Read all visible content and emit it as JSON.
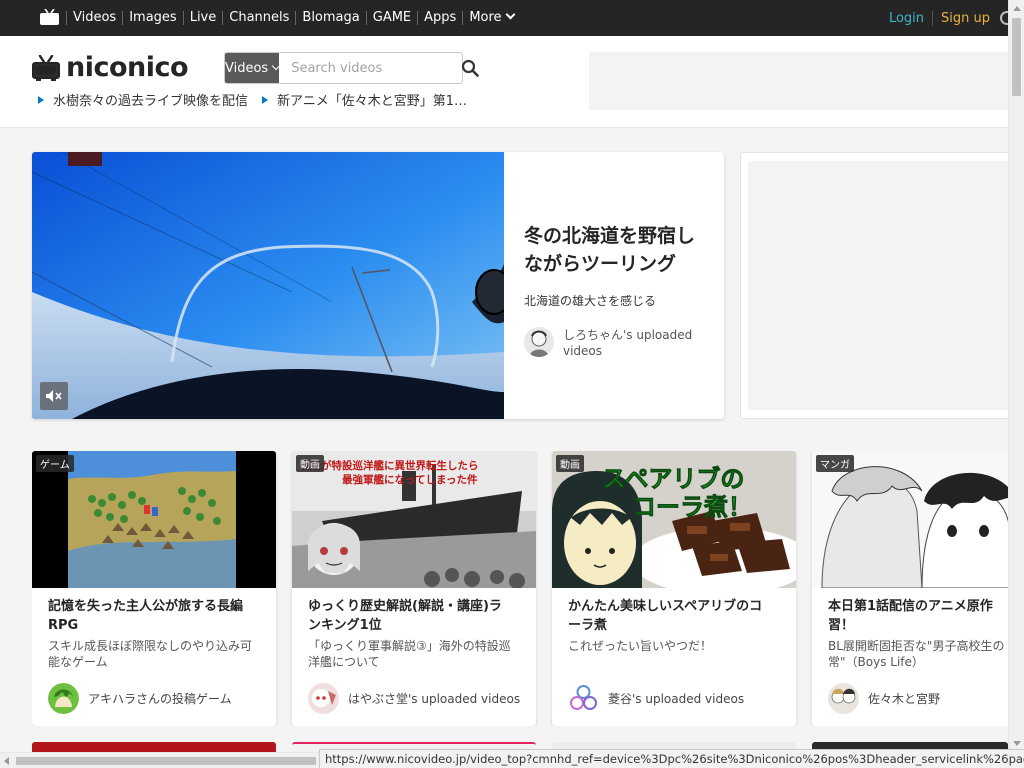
{
  "topbar": {
    "nav": [
      "Videos",
      "Images",
      "Live",
      "Channels",
      "Blomaga",
      "GAME",
      "Apps",
      "More"
    ],
    "login": "Login",
    "signup": "Sign up"
  },
  "header": {
    "brand": "niconico",
    "search_scope": "Videos",
    "search_placeholder": "Search videos",
    "news": [
      "水樹奈々の過去ライブ映像を配信",
      "新アニメ「佐々木と宮野」第1…"
    ]
  },
  "hero": {
    "title_line1": "冬の北海道を野宿し",
    "title_line2": "ながらツーリング",
    "description": "北海道の雄大さを感じる",
    "owner_line1": "しろちゃん's uploaded",
    "owner_line2": "videos"
  },
  "cards": [
    {
      "badge": "ゲーム",
      "title_line1": "記憶を失った主人公が旅する長編",
      "title_line2": "RPG",
      "desc_line1": "スキル成長ほぼ際限なしのやり込み可",
      "desc_line2": "能なゲーム",
      "owner": "アキハラさんの投稿ゲーム"
    },
    {
      "badge": "動画",
      "title_line1": "ゆっくり歴史解説(解説・講座)ラ",
      "title_line2": "ンキング1位",
      "desc_line1": "「ゆっくり軍事解説③」海外の特設巡",
      "desc_line2": "洋艦について",
      "owner": "はやぶさ堂's uploaded videos",
      "thumb_text": "商船が特設巡洋艦に異世界転生したら最強軍艦になってしまった件"
    },
    {
      "badge": "動画",
      "title_line1": "かんたん美味しいスペアリブのコ",
      "title_line2": "ーラ煮",
      "desc_line1": "これぜったい旨いやつだ！",
      "desc_line2": "",
      "owner": "菱谷's uploaded videos",
      "thumb_text_1": "スペアリブの",
      "thumb_text_2": "コーラ煮！"
    },
    {
      "badge": "マンガ",
      "title_line1": "本日第1話配信のアニメ原作",
      "title_line2": "習！",
      "desc_line1": "BL展開断固拒否な\"男子高校生の",
      "desc_line2": "常\"（Boys Life）",
      "owner": "佐々木と宮野"
    }
  ],
  "status_url": "https://www.nicovideo.jp/video_top?cmnhd_ref=device%3Dpc%26site%3Dniconico%26pos%3Dheader_servicelink%26page%3Dtop"
}
